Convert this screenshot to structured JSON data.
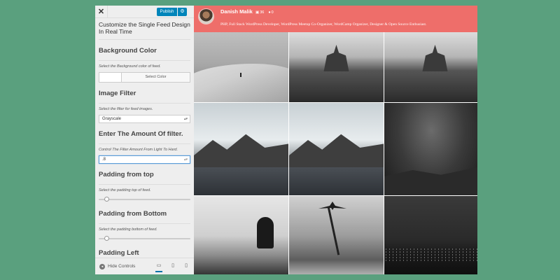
{
  "customizer": {
    "close_label": "✕",
    "publish_label": "Publish",
    "gear_icon": "gear-icon",
    "panel_title": "Customize the Single Feed Design In Real Time",
    "background_color": {
      "heading": "Background Color",
      "description": "Select the Background color of feed.",
      "button_label": "Select Color",
      "current_color": "#ffffff"
    },
    "image_filter": {
      "heading": "Image Filter",
      "description": "Select the filter for feed images.",
      "selected": "Grayscale"
    },
    "filter_amount": {
      "heading": "Enter The Amount Of filter.",
      "description": "Control The Filter Amount From Light To Hard.",
      "value": ".8"
    },
    "padding_top": {
      "heading": "Padding from top",
      "description": "Select the padding top of feed."
    },
    "padding_bottom": {
      "heading": "Padding from Bottom",
      "description": "Select the padding bottom of feed."
    },
    "padding_left": {
      "heading": "Padding Left"
    },
    "hide_controls_label": "Hide Controls"
  },
  "profile": {
    "username": "Danish Malik",
    "posts_count": "36",
    "followers_count": "0",
    "bio": "PHP, Full Stack WordPress Developer, WordPress Meetup Co-Organizer, WordCamp Organizer, Designer & Open Source Enthusiast."
  },
  "colors": {
    "header_bg": "#ee6e6a",
    "page_bg": "#5aa07e",
    "publish_bg": "#0085ba"
  }
}
